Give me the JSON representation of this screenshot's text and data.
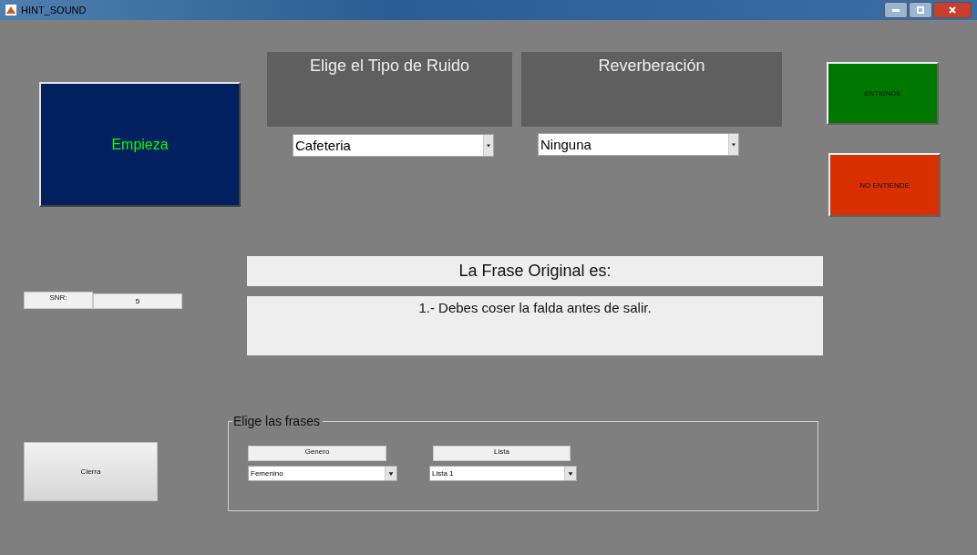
{
  "window": {
    "title": "HINT_SOUND"
  },
  "start_button": "Empieza",
  "noise": {
    "title": "Elige el Tipo de Ruido",
    "value": "Cafeteria"
  },
  "reverb": {
    "title": "Reverberación",
    "value": "Ninguna"
  },
  "answer_buttons": [
    {
      "label": "ENTIENDE",
      "kind": "yes"
    },
    {
      "label": "NO ENTIENDE",
      "kind": "no"
    }
  ],
  "snr": {
    "label": "SNR:",
    "value": "5"
  },
  "sentence": {
    "heading": "La Frase Original es:",
    "text": "1.- Debes coser la falda antes de salir."
  },
  "close_button": "Cierra",
  "phrases": {
    "title": "Elige las frases",
    "fields": [
      {
        "label": "Genero",
        "value": "Femenino"
      },
      {
        "label": "Lista",
        "value": "Lista 1"
      }
    ]
  }
}
